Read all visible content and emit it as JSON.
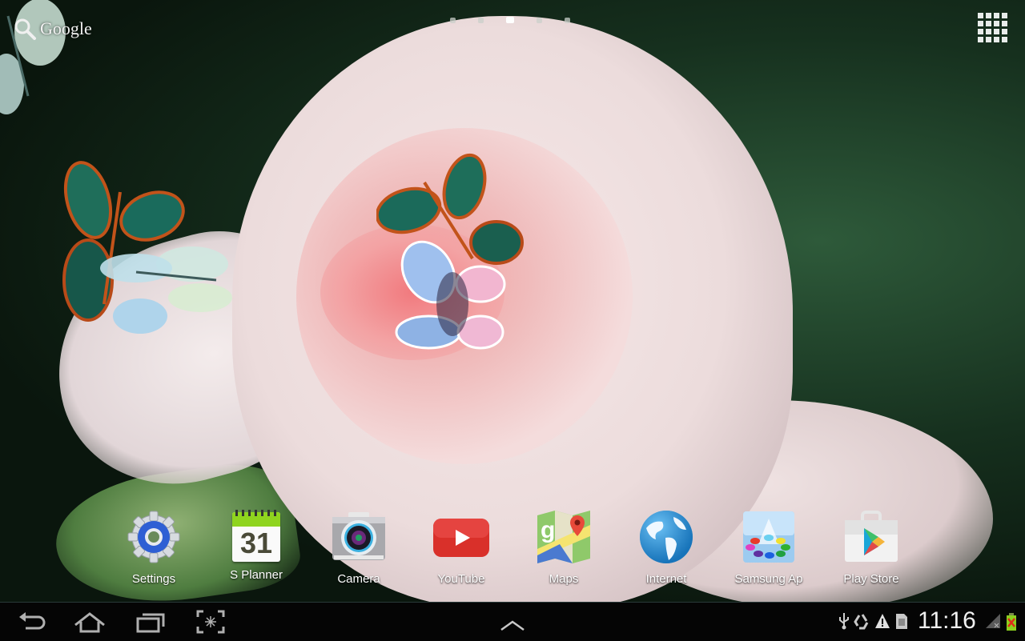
{
  "search_widget": {
    "label": "Google",
    "icon": "search-icon"
  },
  "page_indicator": {
    "total_pages": 5,
    "current_page": 3
  },
  "apps_button": {
    "icon": "app-grid-icon"
  },
  "dock": {
    "apps": [
      {
        "label": "Settings",
        "icon": "settings-gear-icon"
      },
      {
        "label": "S Planner",
        "icon": "calendar-icon",
        "calendar_day": "31"
      },
      {
        "label": "Camera",
        "icon": "camera-icon"
      },
      {
        "label": "YouTube",
        "icon": "youtube-play-icon"
      },
      {
        "label": "Maps",
        "icon": "maps-icon"
      },
      {
        "label": "Internet",
        "icon": "globe-icon"
      },
      {
        "label": "Samsung Ap",
        "icon": "samsung-apps-icon"
      },
      {
        "label": "Play Store",
        "icon": "play-store-bag-icon"
      }
    ]
  },
  "navbar": {
    "buttons": [
      {
        "name": "back",
        "icon": "back-arrow-icon"
      },
      {
        "name": "home",
        "icon": "home-icon"
      },
      {
        "name": "recent-apps",
        "icon": "recent-apps-icon"
      },
      {
        "name": "screenshot",
        "icon": "screen-capture-icon"
      }
    ],
    "center": {
      "icon": "chevron-up-icon"
    }
  },
  "status": {
    "time": "11:16",
    "icons": [
      "usb-icon",
      "recycle-icon",
      "warning-icon",
      "sd-card-icon",
      "no-signal-icon",
      "battery-error-icon"
    ]
  },
  "colors": {
    "navbar_bg": "#050505",
    "label_text": "#ffffff",
    "youtube_red": "#d9302a",
    "splanner_green": "#8fd41e"
  }
}
